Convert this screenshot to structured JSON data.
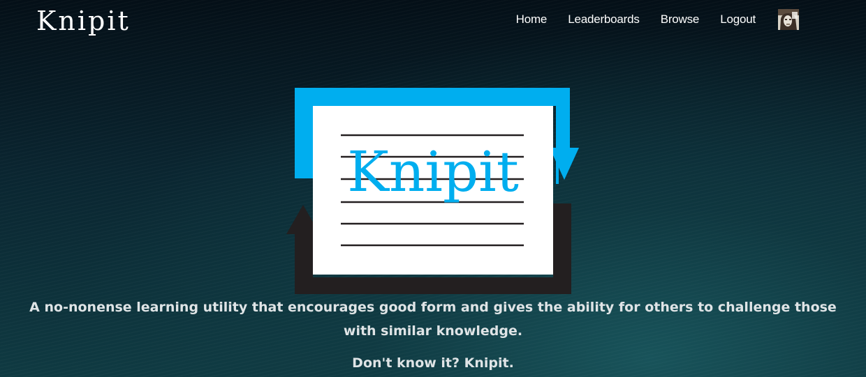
{
  "header": {
    "brand": "Knipit",
    "nav": [
      {
        "label": "Home"
      },
      {
        "label": "Leaderboards"
      },
      {
        "label": "Browse"
      },
      {
        "label": "Logout"
      }
    ],
    "avatar_icon": "user-avatar"
  },
  "hero": {
    "logo_text": "Knipit",
    "tagline": "A no-nonense learning utility that encourages good form and gives the ability for others to challenge those with similar knowledge.",
    "motto": "Don't know it? Knipit."
  },
  "colors": {
    "logo_blue": "#00aeef",
    "logo_dark": "#231f20",
    "background": "#071a22"
  }
}
